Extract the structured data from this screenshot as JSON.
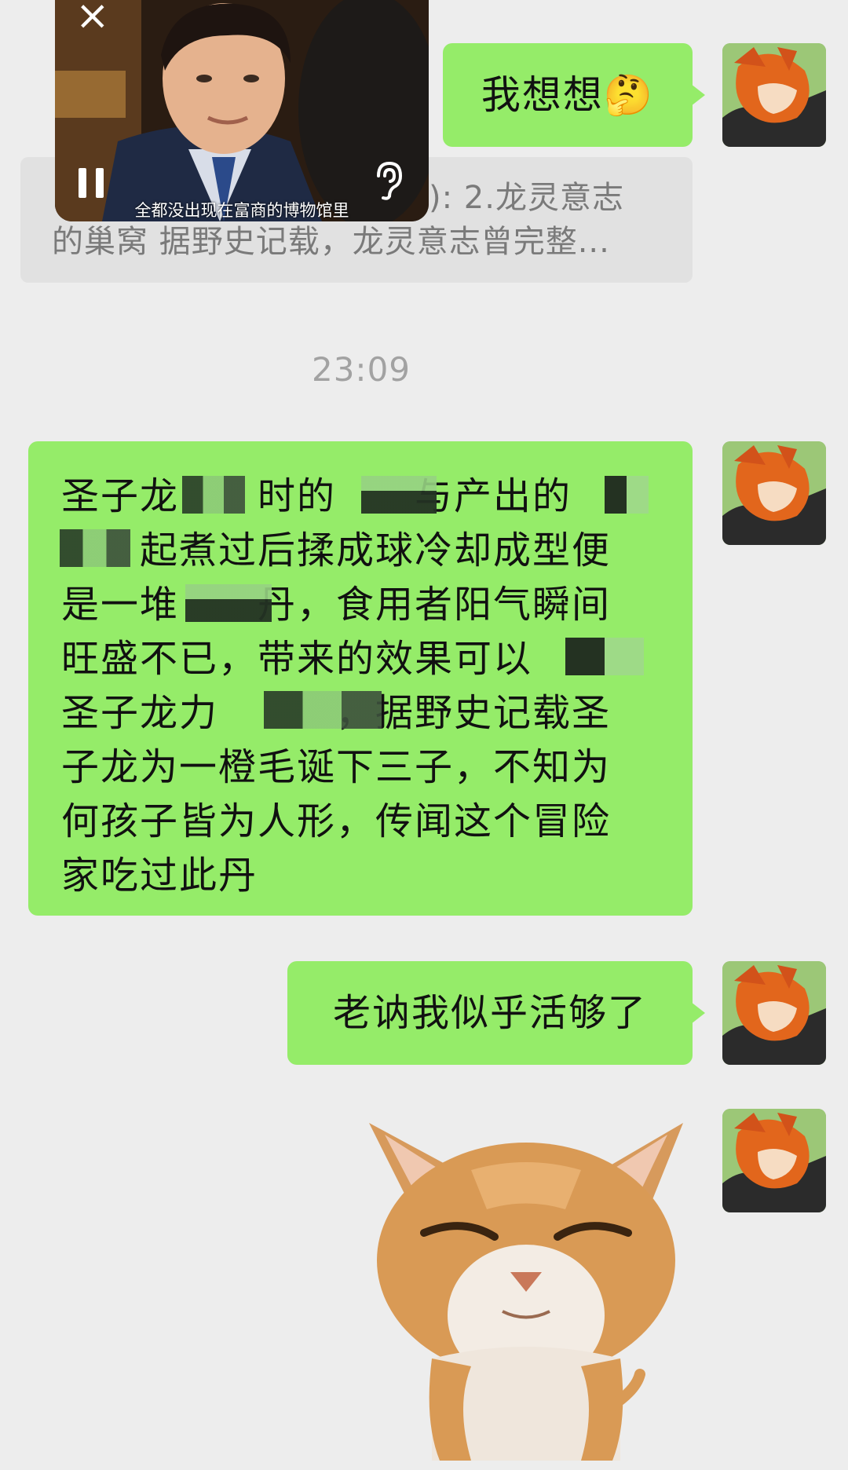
{
  "video": {
    "subtitle": "全都没出现在富商的博物馆里",
    "close_icon": "×"
  },
  "messages": {
    "m1": {
      "text": "我想想🤔"
    },
    "quote": {
      "line1": "): 2.龙灵意志",
      "line2": "的巢窝 据野史记载，龙灵意志曾完整..."
    },
    "time": "23:09",
    "m2": {
      "lines": [
        "圣子龙　　时的　　与产出的",
        "　　起煮过后揉成球冷却成型便",
        "是一堆　　丹，食用者阳气瞬间",
        "旺盛不已，带来的效果可以",
        "圣子龙力　　　，据野史记载圣",
        "子龙为一橙毛诞下三子，不知为",
        "何孩子皆为人形，传闻这个冒险",
        "家吃过此丹"
      ]
    },
    "m3": {
      "text": "老讷我似乎活够了"
    }
  },
  "colors": {
    "background": "#ededed",
    "bubble_green": "#95ec69",
    "quote_gray": "#e1e1e1",
    "time_gray": "#a2a2a2"
  }
}
